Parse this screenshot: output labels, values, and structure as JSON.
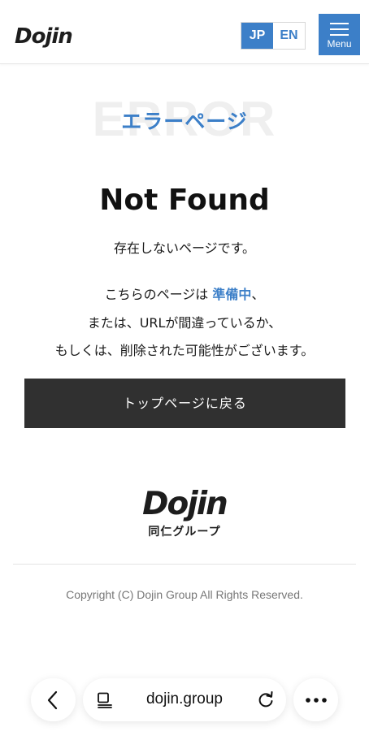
{
  "header": {
    "logo_text": "Dojin",
    "lang": {
      "jp": "JP",
      "en": "EN"
    },
    "menu_label": "Menu"
  },
  "main": {
    "bg_word": "ERROR",
    "heading": "エラーページ",
    "title": "Not Found",
    "subtitle": "存在しないページです。",
    "line1_prefix": "こちらのページは ",
    "line1_accent": "準備中",
    "line1_suffix": "、",
    "line2": "または、URLが間違っているか、",
    "line3": "もしくは、削除された可能性がございます。",
    "top_button": "トップページに戻る"
  },
  "footer": {
    "logo_text": "Dojin",
    "group_name": "同仁グループ",
    "copyright": "Copyright (C) Dojin Group All Rights Reserved."
  },
  "browser": {
    "url": "dojin.group",
    "icons": [
      "chevron-left-icon",
      "tabs-icon",
      "reload-icon",
      "more-icon"
    ]
  },
  "colors": {
    "accent": "#3c7fc8",
    "button_dark": "#303030"
  }
}
